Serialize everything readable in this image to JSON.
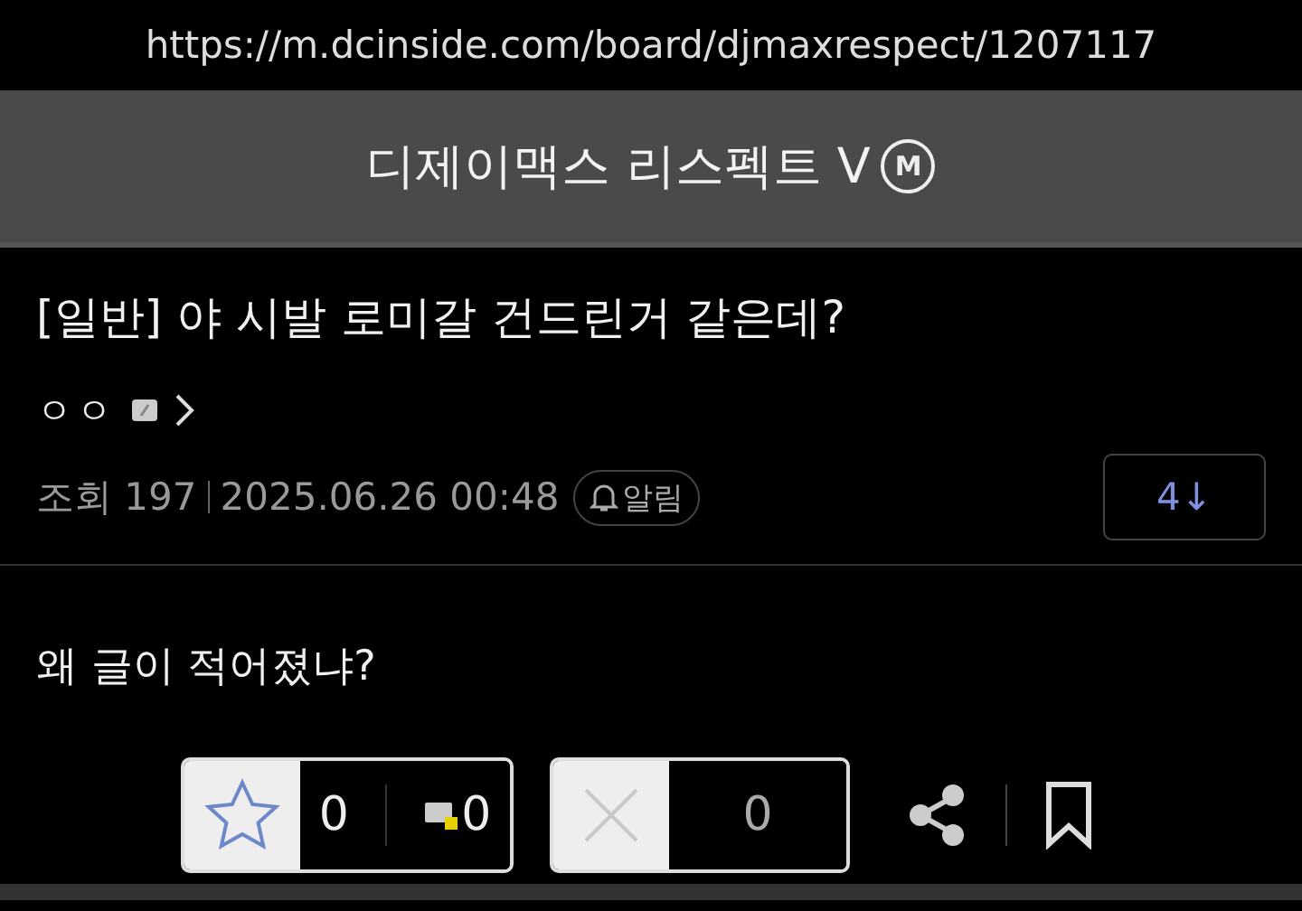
{
  "url": "https://m.dcinside.com/board/djmaxrespect/1207117",
  "gallery": {
    "title": "디제이맥스 리스펙트 V",
    "badge": "M"
  },
  "post": {
    "title": "[일반] 야 시발 로미갈 건드린거 같은데?",
    "author": "ㅇㅇ",
    "views_label": "조회 197",
    "date": "2025.06.26 00:48",
    "alert_label": "알림",
    "comment_count": "4↓",
    "body": "왜 글이 적어졌냐?"
  },
  "actions": {
    "recommend": "0",
    "fixed_recommend": "0",
    "downvote": "0"
  }
}
